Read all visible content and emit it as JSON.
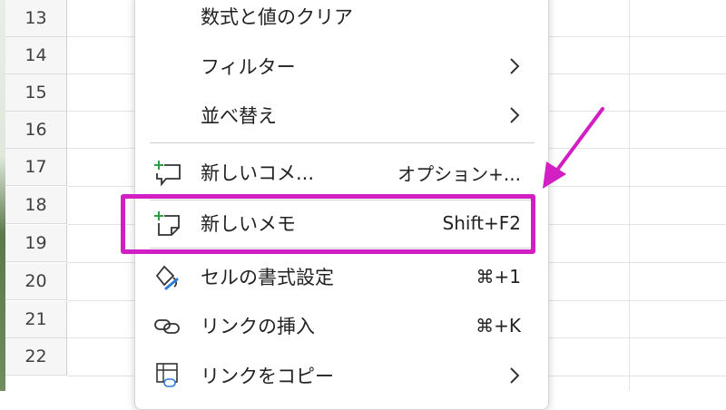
{
  "row_headers": [
    "13",
    "14",
    "15",
    "16",
    "17",
    "18",
    "19",
    "20",
    "21",
    "22"
  ],
  "context_menu": {
    "items": [
      {
        "label": "数式と値のクリア",
        "icon": "",
        "shortcut": "",
        "has_submenu": false
      },
      {
        "label": "フィルター",
        "icon": "",
        "shortcut": "",
        "has_submenu": true
      },
      {
        "label": "並べ替え",
        "icon": "",
        "shortcut": "",
        "has_submenu": true
      },
      {
        "label": "新しいコメ...",
        "icon": "new-comment-icon",
        "shortcut": "オプション+...",
        "has_submenu": false
      },
      {
        "label": "新しいメモ",
        "icon": "new-note-icon",
        "shortcut": "Shift+F2",
        "has_submenu": false
      },
      {
        "label": "セルの書式設定",
        "icon": "format-paint-icon",
        "shortcut": "⌘+1",
        "has_submenu": false
      },
      {
        "label": "リンクの挿入",
        "icon": "link-icon",
        "shortcut": "⌘+K",
        "has_submenu": false
      },
      {
        "label": "リンクをコピー",
        "icon": "copy-link-icon",
        "shortcut": "",
        "has_submenu": true
      }
    ]
  },
  "annotation": {
    "highlight_color": "#d21fc4",
    "highlighted_item": "新しいメモ"
  },
  "colors": {
    "icon_green": "#2e9e44",
    "text": "#222222",
    "row_header_bg": "#f6f6f6"
  }
}
